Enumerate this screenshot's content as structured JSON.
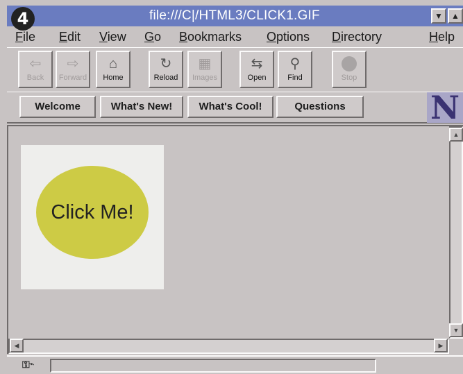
{
  "step_badge": "4",
  "window": {
    "title": "file:///C|/HTML3/CLICK1.GIF"
  },
  "menu": [
    {
      "pre": "",
      "u": "F",
      "post": "ile"
    },
    {
      "pre": "",
      "u": "E",
      "post": "dit"
    },
    {
      "pre": "",
      "u": "V",
      "post": "iew"
    },
    {
      "pre": "",
      "u": "G",
      "post": "o"
    },
    {
      "pre": "",
      "u": "B",
      "post": "ookmarks"
    },
    {
      "pre": "",
      "u": "O",
      "post": "ptions"
    },
    {
      "pre": "",
      "u": "D",
      "post": "irectory"
    },
    {
      "pre": "",
      "u": "H",
      "post": "elp"
    }
  ],
  "toolbar": {
    "back": {
      "label": "Back",
      "icon": "back-arrow-icon",
      "enabled": false
    },
    "forward": {
      "label": "Forward",
      "icon": "forward-arrow-icon",
      "enabled": false
    },
    "home": {
      "label": "Home",
      "icon": "house-icon",
      "enabled": true
    },
    "reload": {
      "label": "Reload",
      "icon": "reload-icon",
      "enabled": true
    },
    "images": {
      "label": "Images",
      "icon": "images-icon",
      "enabled": false
    },
    "open": {
      "label": "Open",
      "icon": "open-icon",
      "enabled": true
    },
    "find": {
      "label": "Find",
      "icon": "binoculars-icon",
      "enabled": true
    },
    "stop": {
      "label": "Stop",
      "icon": "stop-sign-icon",
      "enabled": false
    }
  },
  "directory_buttons": [
    "Welcome",
    "What's New!",
    "What's Cool!",
    "Questions"
  ],
  "content": {
    "click_text": "Click Me!",
    "ellipse_color": "#cdcb45",
    "image_background": "#eeeeec"
  },
  "colors": {
    "titlebar": "#6a7cc0",
    "chrome": "#c8c3c3"
  }
}
